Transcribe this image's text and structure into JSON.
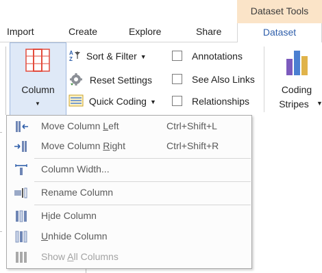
{
  "context_header": {
    "label": "Dataset Tools"
  },
  "tabs": [
    {
      "label": "Import"
    },
    {
      "label": "Create"
    },
    {
      "label": "Explore"
    },
    {
      "label": "Share"
    },
    {
      "label": "Dataset",
      "active": true
    }
  ],
  "ribbon": {
    "column_button": {
      "label": "Column",
      "icon": "column-grid-icon"
    },
    "commands": [
      {
        "label": "Sort & Filter",
        "icon": "sort-az-icon",
        "has_dropdown": true
      },
      {
        "label": "Reset Settings",
        "icon": "reset-gear-icon",
        "has_dropdown": false
      },
      {
        "label": "Quick Coding",
        "icon": "quick-coding-icon",
        "has_dropdown": true
      }
    ],
    "checkboxes": [
      {
        "label": "Annotations",
        "checked": false
      },
      {
        "label": "See Also Links",
        "checked": false
      },
      {
        "label": "Relationships",
        "checked": false
      }
    ],
    "coding_stripes": {
      "line1": "Coding",
      "line2": "Stripes",
      "icon": "coding-stripes-icon"
    }
  },
  "menu": {
    "items": [
      {
        "pre": "Move Column ",
        "u": "L",
        "post": "eft",
        "shortcut": "Ctrl+Shift+L",
        "icon": "move-left-icon",
        "enabled": true
      },
      {
        "pre": "Move Column ",
        "u": "R",
        "post": "ight",
        "shortcut": "Ctrl+Shift+R",
        "icon": "move-right-icon",
        "enabled": true
      },
      {
        "pre": "Column Width...",
        "u": "",
        "post": "",
        "shortcut": "",
        "icon": "column-width-icon",
        "enabled": true
      },
      {
        "pre": "Rename Column",
        "u": "",
        "post": "",
        "shortcut": "",
        "icon": "rename-column-icon",
        "enabled": true
      },
      {
        "pre": "H",
        "u": "i",
        "post": "de Column",
        "shortcut": "",
        "icon": "hide-column-icon",
        "enabled": true
      },
      {
        "pre": "",
        "u": "U",
        "post": "nhide Column",
        "shortcut": "",
        "icon": "unhide-column-icon",
        "enabled": true
      },
      {
        "pre": "Show ",
        "u": "A",
        "post": "ll Columns",
        "shortcut": "",
        "icon": "show-all-columns-icon",
        "enabled": false
      }
    ]
  },
  "colors": {
    "context_tab_bg": "#fbe4c8",
    "active_tab_text": "#2e5eaa",
    "selected_button_bg": "#dfe9f7",
    "column_icon_red": "#e34b3c",
    "stripe_blue": "#4b7fd1",
    "stripe_purple": "#7c5bbd",
    "stripe_gold": "#e0b34a"
  }
}
